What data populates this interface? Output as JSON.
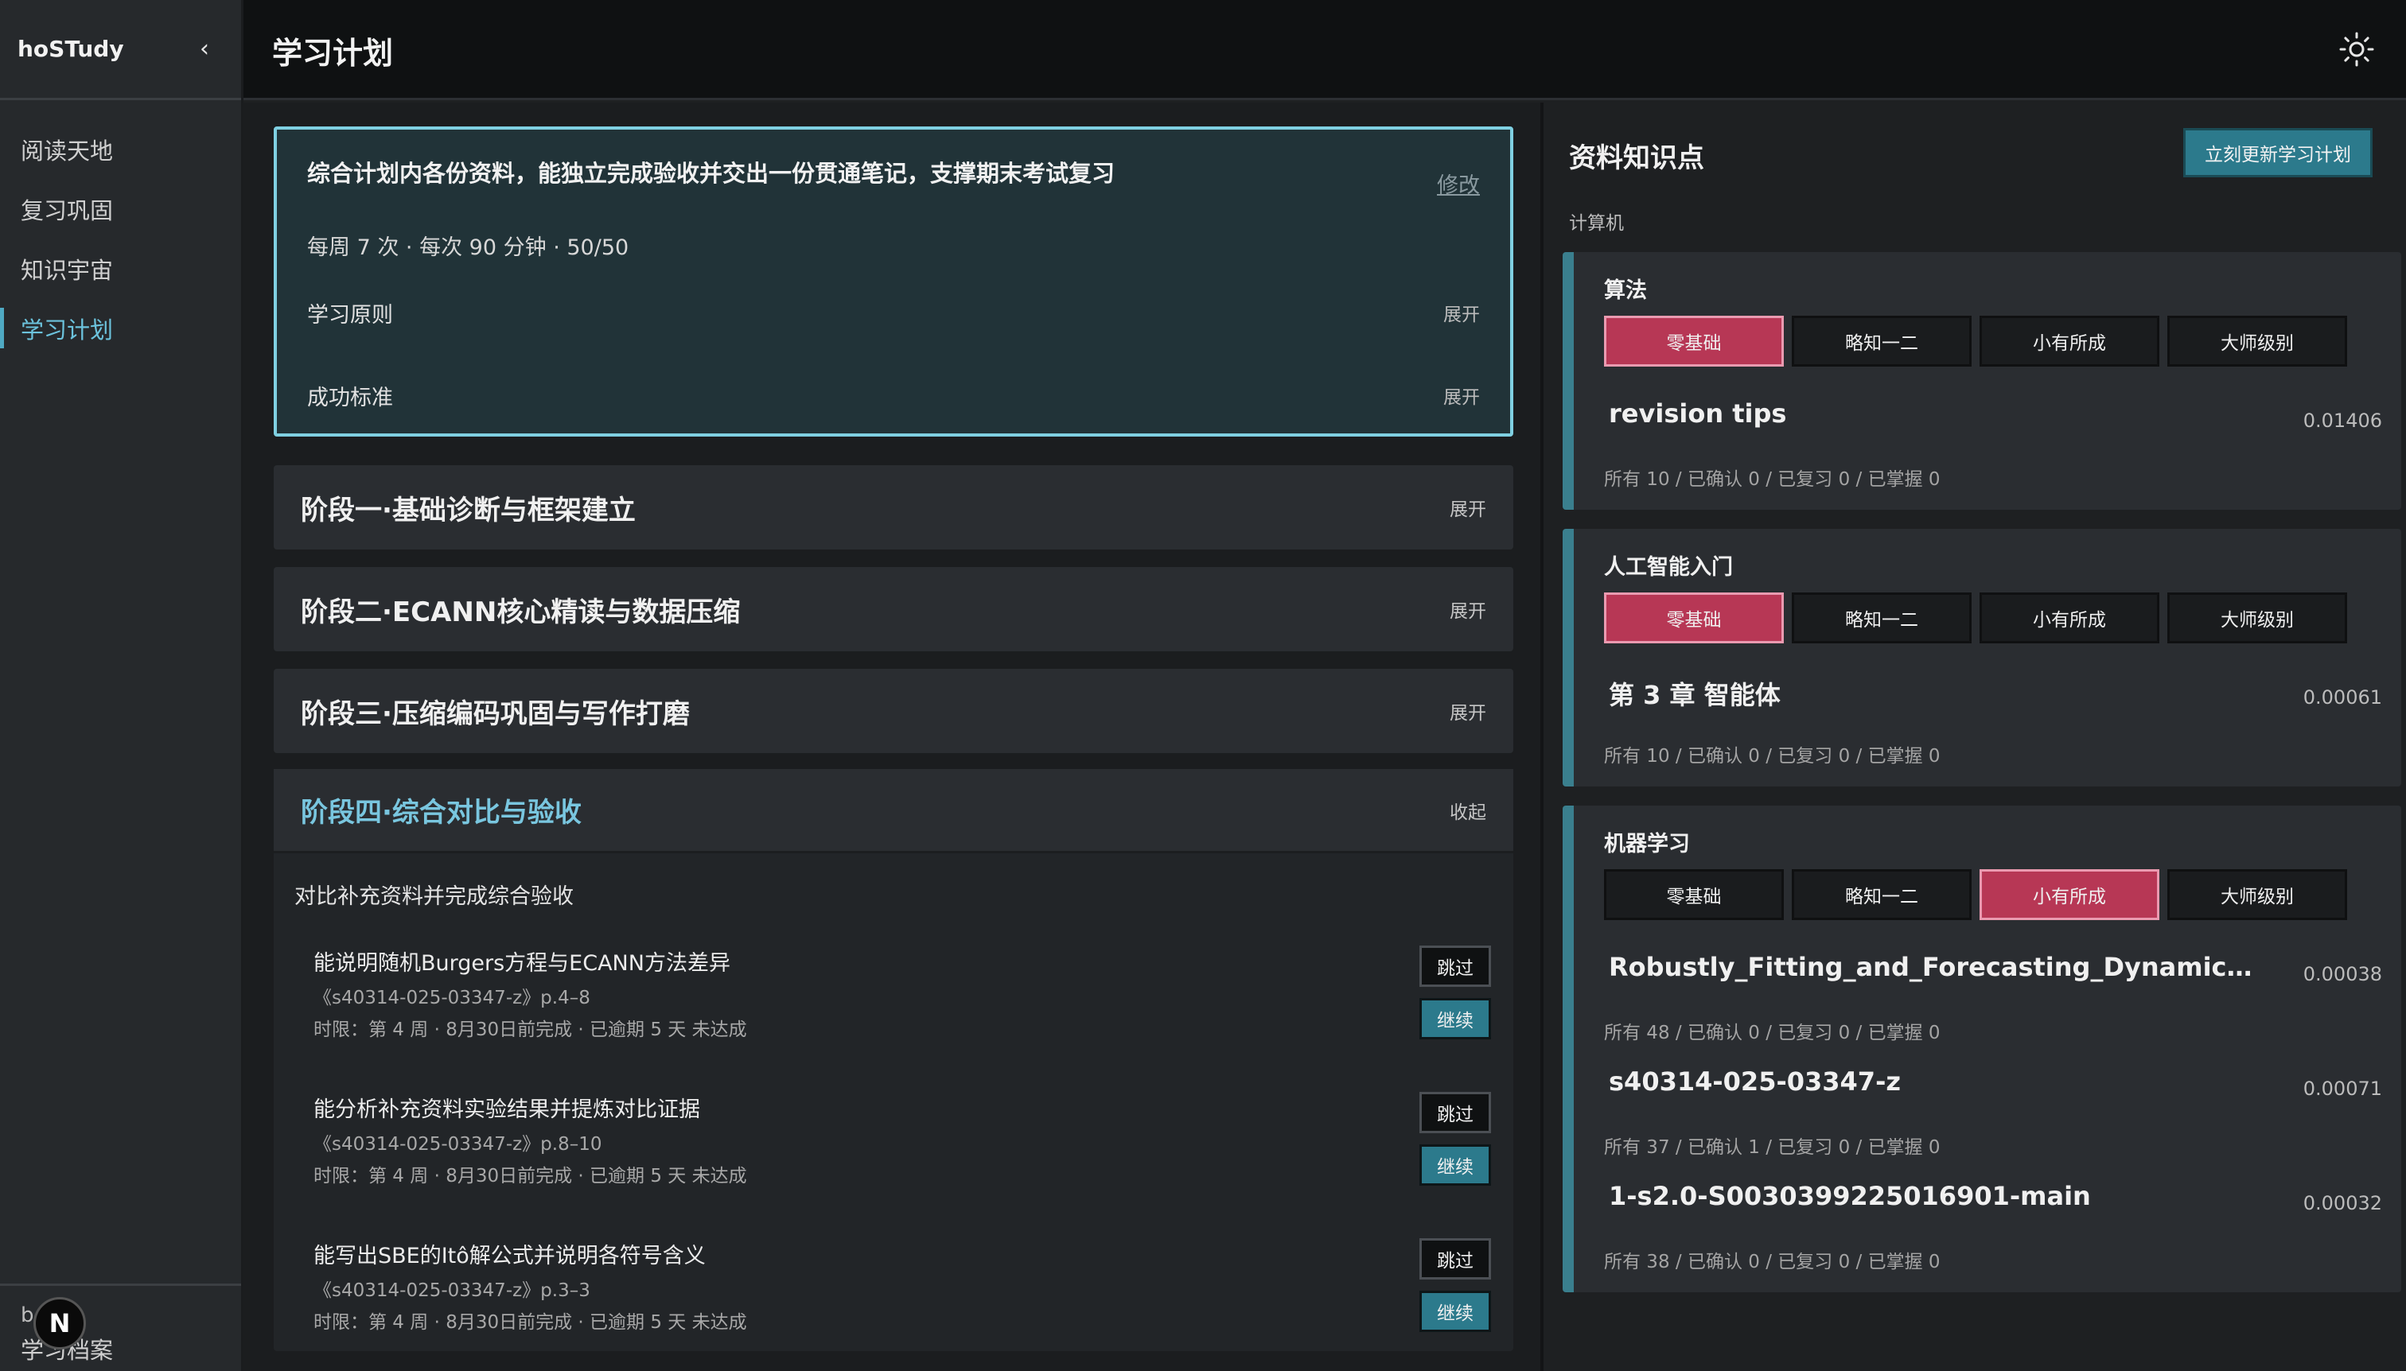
{
  "app": {
    "name": "hoSTudy",
    "collapse_icon": "‹"
  },
  "nav": [
    {
      "label": "阅读天地"
    },
    {
      "label": "复习巩固"
    },
    {
      "label": "知识宇宙"
    },
    {
      "label": "学习计划"
    }
  ],
  "sidebar_bottom": {
    "small_text": "b",
    "label": "学习档案",
    "badge": "N"
  },
  "topbar": {
    "title": "学习计划",
    "theme_icon": "sun-icon"
  },
  "goal": {
    "text": "综合计划内各份资料，能独立完成验收并交出一份贯通笔记，支撑期末考试复习",
    "edit_label": "修改",
    "meta": "每周 7 次 · 每次 90 分钟 · 50/50",
    "principles_label": "学习原则",
    "principles_toggle": "展开",
    "criteria_label": "成功标准",
    "criteria_toggle": "展开"
  },
  "stages": [
    {
      "title": "阶段一·基础诊断与框架建立",
      "toggle": "展开"
    },
    {
      "title": "阶段二·ECANN核心精读与数据压缩",
      "toggle": "展开"
    },
    {
      "title": "阶段三·压缩编码巩固与写作打磨",
      "toggle": "展开"
    },
    {
      "title": "阶段四·综合对比与验收",
      "toggle": "收起"
    }
  ],
  "stage4": {
    "description": "对比补充资料并完成综合验收",
    "tasks": [
      {
        "title": "能说明随机Burgers方程与ECANN方法差异",
        "source": "《s40314-025-03347-z》p.4–8",
        "meta": "时限：第 4 周 · 8月30日前完成 · 已逾期 5 天   未达成",
        "skip": "跳过",
        "continue": "继续"
      },
      {
        "title": "能分析补充资料实验结果并提炼对比证据",
        "source": "《s40314-025-03347-z》p.8–10",
        "meta": "时限：第 4 周 · 8月30日前完成 · 已逾期 5 天   未达成",
        "skip": "跳过",
        "continue": "继续"
      },
      {
        "title": "能写出SBE的Itô解公式并说明各符号含义",
        "source": "《s40314-025-03347-z》p.3–3",
        "meta": "时限：第 4 周 · 8月30日前完成 · 已逾期 5 天   未达成",
        "skip": "跳过",
        "continue": "继续"
      }
    ]
  },
  "knowledge": {
    "title": "资料知识点",
    "update_button": "立刻更新学习计划",
    "category": "计算机",
    "level_labels": [
      "零基础",
      "略知一二",
      "小有所成",
      "大师级别"
    ],
    "subjects": [
      {
        "name": "算法",
        "selected_level": 0,
        "resources": [
          {
            "name": "revision tips",
            "score": "0.01406",
            "stats": "所有 10 / 已确认 0 / 已复习 0 / 已掌握 0"
          }
        ]
      },
      {
        "name": "人工智能入门",
        "selected_level": 0,
        "resources": [
          {
            "name": "第 3 章 智能体",
            "score": "0.00061",
            "stats": "所有 10 / 已确认 0 / 已复习 0 / 已掌握 0"
          }
        ]
      },
      {
        "name": "机器学习",
        "selected_level": 2,
        "resources": [
          {
            "name": "Robustly_Fitting_and_Forecasting_Dynamical_Dat...",
            "score": "0.00038",
            "stats": "所有 48 / 已确认 0 / 已复习 0 / 已掌握 0"
          },
          {
            "name": "s40314-025-03347-z",
            "score": "0.00071",
            "stats": "所有 37 / 已确认 1 / 已复习 0 / 已掌握 0"
          },
          {
            "name": "1-s2.0-S0030399225016901-main",
            "score": "0.00032",
            "stats": "所有 38 / 已确认 0 / 已复习 0 / 已掌握 0"
          }
        ]
      }
    ]
  }
}
